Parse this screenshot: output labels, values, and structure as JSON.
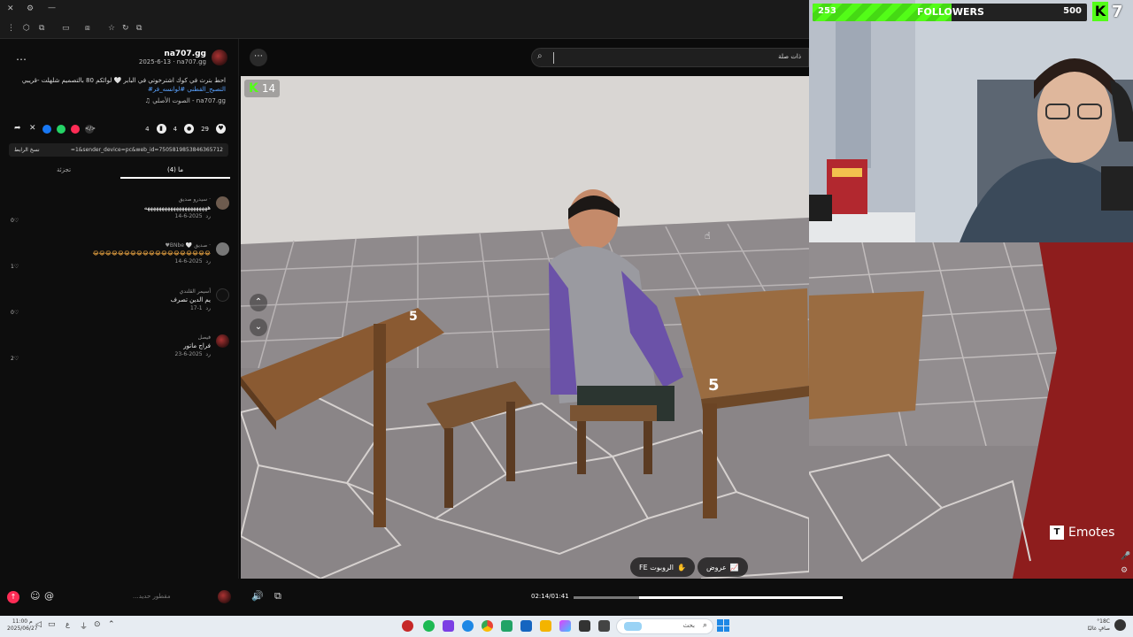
{
  "browser": {
    "search_placeholder": "ذات صلة"
  },
  "post": {
    "author": "na707.gg",
    "date_line": "2025-6-13 · na707.gg",
    "caption_line1": "احط بترث في كوك اشترخوتي في البابر 🤍 لوائكم 80 بالتصميم شلهلت -قريبي",
    "caption_line2": "#التصبح_القطني #لوانسه_فر",
    "sound_line": "الصوت الأصلي - na707.gg",
    "likes": "29",
    "comments": "4",
    "saves": "4",
    "link": "=1&sender_device=pc&web_id=7505819853846365712",
    "copy_link": "نسخ الرابط",
    "tab_comments": "(4) ما",
    "tab_creator": "تجزئة"
  },
  "comments": [
    {
      "name": "سيدرو صديق ·",
      "text": "ههههههههههههههههههههههه",
      "date": "2025-6-14",
      "reply": "رد",
      "likes": "0"
    },
    {
      "name": "♥BNbe 🤍 صديق ·",
      "text": "😂😂😂😂😂😂😂😂😂😂😂😂😂😂😂😂😂😂😂",
      "date": "2025-6-14",
      "reply": "رد",
      "likes": "1"
    },
    {
      "name": "أسيمر القلندي",
      "text": "يم الدين تصرف",
      "date": "1-17",
      "reply": "رد",
      "likes": "0"
    },
    {
      "name": "فيصل",
      "text": "فراج ماتور",
      "date": "2025-6-23",
      "reply": "رد",
      "likes": "2"
    }
  ],
  "comment_input_placeholder": "...مقطور حديد",
  "overlay": {
    "game_counter": "14",
    "emotes_label": "Emotes",
    "fe_label": "FE الروبوت",
    "offers_label": "عروض",
    "time": "02:14/01:41"
  },
  "followers": {
    "current": "253",
    "label": "FOLLOWERS",
    "goal": "500",
    "kick_count": "7",
    "progress": 0.506
  },
  "taskbar": {
    "search_label": "بحث",
    "weather": "°18C",
    "weather_sub": "صافٍ غالبًا",
    "clock": "11:00 م",
    "date": "2025/06/27"
  },
  "colors": {
    "accent": "#53fc18",
    "brand_blue": "#5aa2ff"
  }
}
